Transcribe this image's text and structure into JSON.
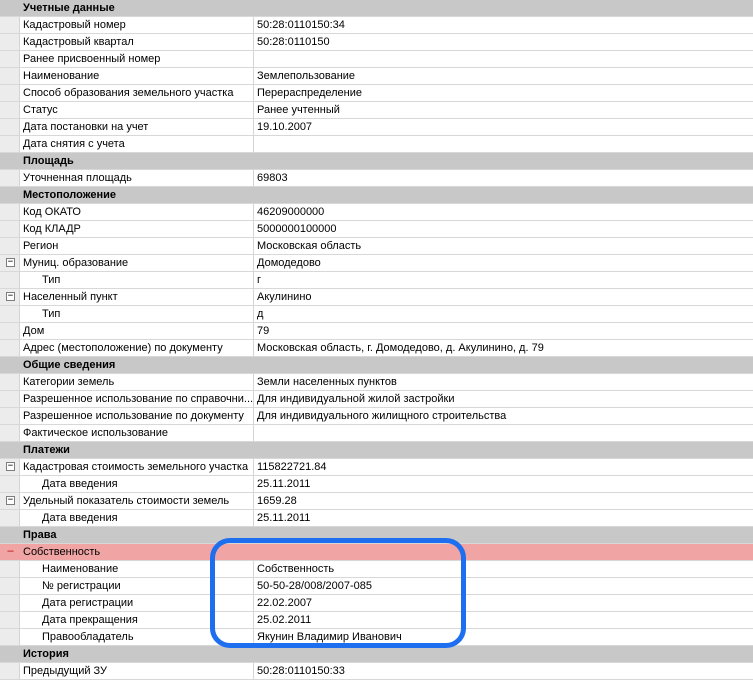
{
  "rows": [
    {
      "kind": "section",
      "name": "Учетные данные",
      "value": ""
    },
    {
      "kind": "prop",
      "name": "Кадастровый номер",
      "value": "50:28:0110150:34"
    },
    {
      "kind": "prop",
      "name": "Кадастровый квартал",
      "value": "50:28:0110150"
    },
    {
      "kind": "prop",
      "name": "Ранее присвоенный номер",
      "value": ""
    },
    {
      "kind": "prop",
      "name": "Наименование",
      "value": "Землепользование"
    },
    {
      "kind": "prop",
      "name": "Способ образования земельного участка",
      "value": "Перераспределение"
    },
    {
      "kind": "prop",
      "name": "Статус",
      "value": "Ранее учтенный"
    },
    {
      "kind": "prop",
      "name": "Дата постановки на учет",
      "value": "19.10.2007"
    },
    {
      "kind": "prop",
      "name": "Дата снятия с учета",
      "value": ""
    },
    {
      "kind": "section",
      "name": "Площадь",
      "value": ""
    },
    {
      "kind": "prop",
      "name": "Уточненная площадь",
      "value": "69803"
    },
    {
      "kind": "section",
      "name": "Местоположение",
      "value": ""
    },
    {
      "kind": "prop",
      "name": "Код ОКАТО",
      "value": "46209000000"
    },
    {
      "kind": "prop",
      "name": "Код КЛАДР",
      "value": "5000000100000"
    },
    {
      "kind": "prop",
      "name": "Регион",
      "value": "Московская область"
    },
    {
      "kind": "group",
      "name": "Муниц. образование",
      "value": "Домодедово",
      "expander": "−"
    },
    {
      "kind": "sub",
      "name": "Тип",
      "value": "г"
    },
    {
      "kind": "group",
      "name": "Населенный пункт",
      "value": "Акулинино",
      "expander": "−"
    },
    {
      "kind": "sub",
      "name": "Тип",
      "value": "д"
    },
    {
      "kind": "prop",
      "name": "Дом",
      "value": "79"
    },
    {
      "kind": "prop",
      "name": "Адрес (местоположение) по документу",
      "value": "Московская область, г. Домодедово, д. Акулинино, д. 79"
    },
    {
      "kind": "section",
      "name": "Общие сведения",
      "value": ""
    },
    {
      "kind": "prop",
      "name": "Категории земель",
      "value": "Земли населенных пунктов"
    },
    {
      "kind": "prop",
      "name": "Разрешенное использование по справочни...",
      "value": "Для индивидуальной жилой застройки"
    },
    {
      "kind": "prop",
      "name": "Разрешенное использование по документу",
      "value": "Для индивидуального жилищного строительства"
    },
    {
      "kind": "prop",
      "name": "Фактическое использование",
      "value": ""
    },
    {
      "kind": "section",
      "name": "Платежи",
      "value": ""
    },
    {
      "kind": "group",
      "name": "Кадастровая стоимость земельного участка",
      "value": "115822721.84",
      "expander": "−"
    },
    {
      "kind": "sub",
      "name": "Дата введения",
      "value": "25.11.2011"
    },
    {
      "kind": "group",
      "name": "Удельный показатель стоимости земель",
      "value": "1659.28",
      "expander": "−"
    },
    {
      "kind": "sub",
      "name": "Дата введения",
      "value": "25.11.2011"
    },
    {
      "kind": "section",
      "name": "Права",
      "value": ""
    },
    {
      "kind": "selected",
      "name": "Собственность",
      "value": "",
      "expander": "−"
    },
    {
      "kind": "sub",
      "name": "Наименование",
      "value": "Собственность"
    },
    {
      "kind": "sub",
      "name": "№ регистрации",
      "value": "50-50-28/008/2007-085"
    },
    {
      "kind": "sub",
      "name": "Дата регистрации",
      "value": "22.02.2007"
    },
    {
      "kind": "sub",
      "name": "Дата прекращения",
      "value": "25.02.2011"
    },
    {
      "kind": "sub",
      "name": "Правообладатель",
      "value": "Якунин Владимир Иванович"
    },
    {
      "kind": "section",
      "name": "История",
      "value": ""
    },
    {
      "kind": "prop",
      "name": "Предыдущий ЗУ",
      "value": "50:28:0110150:33"
    }
  ],
  "colors": {
    "section_bg": "#c8c8c8",
    "selected_bg": "#f0a4a4",
    "highlight_border": "#1e6ff0"
  }
}
